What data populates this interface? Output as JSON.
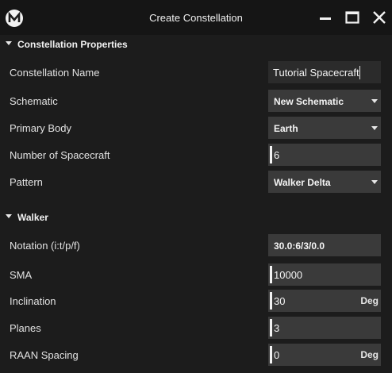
{
  "window": {
    "title": "Create Constellation",
    "logo_icon": "app-logo-icon",
    "controls": [
      "minimize-icon",
      "maximize-icon",
      "close-icon"
    ]
  },
  "sections": {
    "properties": {
      "title": "Constellation Properties",
      "constellation_name": {
        "label": "Constellation Name",
        "value": "Tutorial Spacecraft"
      },
      "schematic": {
        "label": "Schematic",
        "value": "New Schematic"
      },
      "primary_body": {
        "label": "Primary Body",
        "value": "Earth"
      },
      "num_spacecraft": {
        "label": "Number of Spacecraft",
        "value": "6"
      },
      "pattern": {
        "label": "Pattern",
        "value": "Walker Delta"
      }
    },
    "walker": {
      "title": "Walker",
      "notation": {
        "label": "Notation (i:t/p/f)",
        "value": "30.0:6/3/0.0"
      },
      "sma": {
        "label": "SMA",
        "value": "10000"
      },
      "inclination": {
        "label": "Inclination",
        "value": "30",
        "unit": "Deg"
      },
      "planes": {
        "label": "Planes",
        "value": "3"
      },
      "raan_spacing": {
        "label": "RAAN Spacing",
        "value": "0",
        "unit": "Deg"
      }
    }
  },
  "colors": {
    "background": "#1c1c1c",
    "titlebar": "#151515",
    "field": "#3a3a3a",
    "text": "#e8e8e8"
  }
}
